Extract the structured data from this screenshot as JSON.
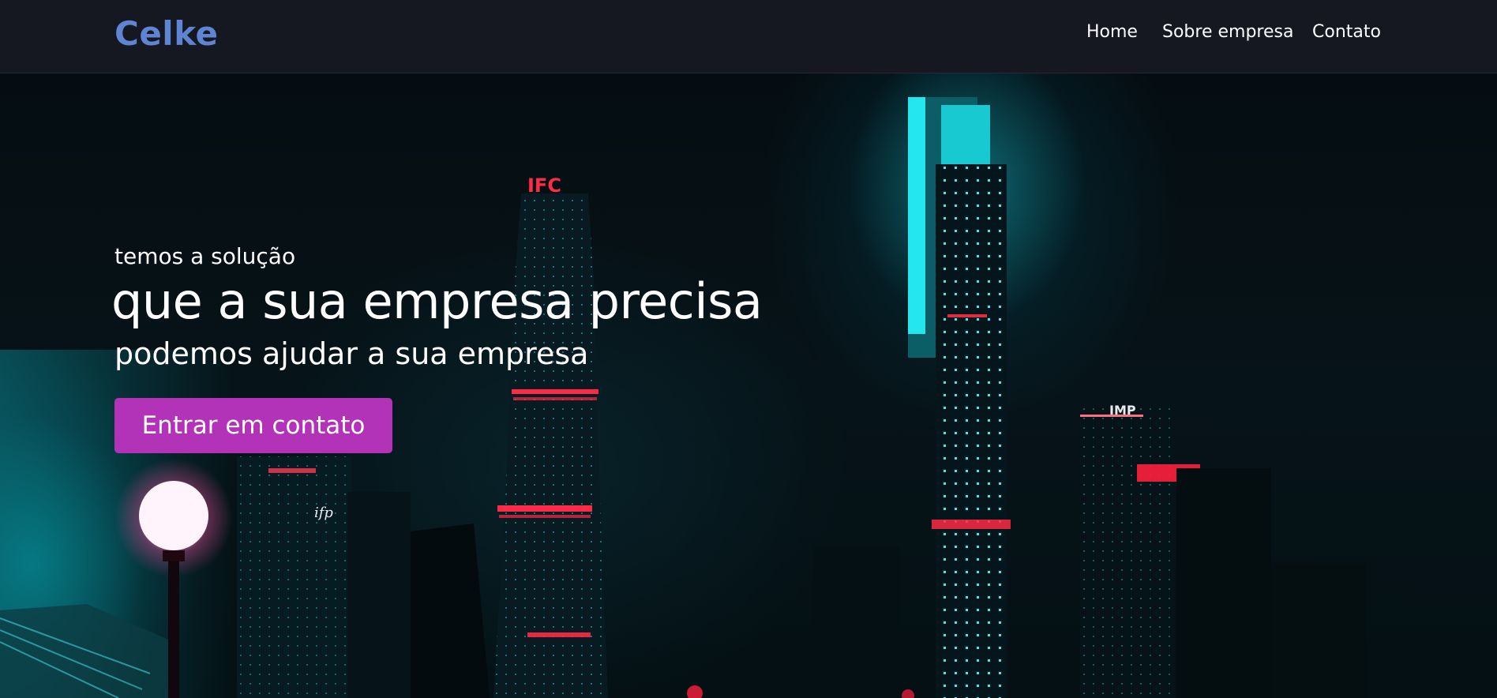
{
  "header": {
    "logo": "Celke",
    "nav": [
      {
        "label": "Home"
      },
      {
        "label": "Sobre empresa"
      },
      {
        "label": "Contato"
      }
    ]
  },
  "hero": {
    "eyebrow": "temos a solução",
    "headline": "que a sua empresa precisa",
    "subheadline": "podemos ajudar a sua empresa",
    "cta_label": "Entrar em contato",
    "sign_ifc": "IFC",
    "sign_imp": "IMP",
    "sign_ifp": "ifp"
  },
  "colors": {
    "header_bg": "#151821",
    "logo": "#5f84d1",
    "cta_bg": "#b232b8",
    "neon_cyan": "#19e3e8",
    "neon_red": "#ff1f3d"
  }
}
